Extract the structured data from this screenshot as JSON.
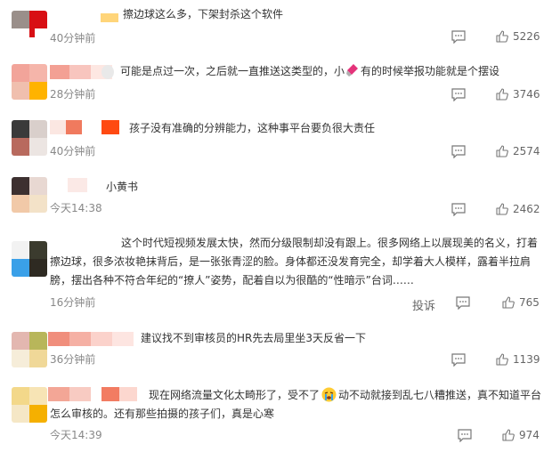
{
  "comments": [
    {
      "text": "擦边球这么多，下架封杀这个软件",
      "time": "40分钟前",
      "likes": "5226"
    },
    {
      "text": "可能是点过一次，之后就一直推送这类型的，小",
      "text_after": "有的时候举报功能就是个摆设",
      "time": "28分钟前",
      "likes": "3746"
    },
    {
      "text": "孩子没有准确的分辨能力，这种事平台要负很大责任",
      "time": "40分钟前",
      "likes": "2574"
    },
    {
      "text": "小黄书",
      "time": "今天14:38",
      "likes": "2462"
    },
    {
      "text_line1": "这个时代短视频发展太快，然而分级限制却没有跟上。很多网络上以展现美的名义，打着",
      "text_line2": "擦边球，很多浓妆艳抹背后，是一张张青涩的脸。身体都还没发育完全，却学着大人模样，露着半拉肩",
      "text_line3": "膀，摆出各种不符合年纪的“撩人”姿势，配着自以为很酷的“性暗示”台词……",
      "time": "16分钟前",
      "report": "投诉",
      "likes": "765"
    },
    {
      "text": "建议找不到审核员的HR先去局里坐3天反省一下",
      "time": "36分钟前",
      "likes": "1139"
    },
    {
      "text_line1_a": "现在网络流量文化太畸形了，受不了",
      "text_line1_b": "动不动就接到乱七八糟推送，真不知道平台",
      "text_line2": "怎么审核的。还有那些拍摄的孩子们，真是心寒",
      "time": "今天14:39",
      "likes": "974"
    }
  ],
  "icons": {
    "comment": "comment-bubble-icon",
    "like": "thumbs-up-icon",
    "crying": "crying-emoji-icon",
    "lipstick": "lipstick-emoji-icon"
  }
}
